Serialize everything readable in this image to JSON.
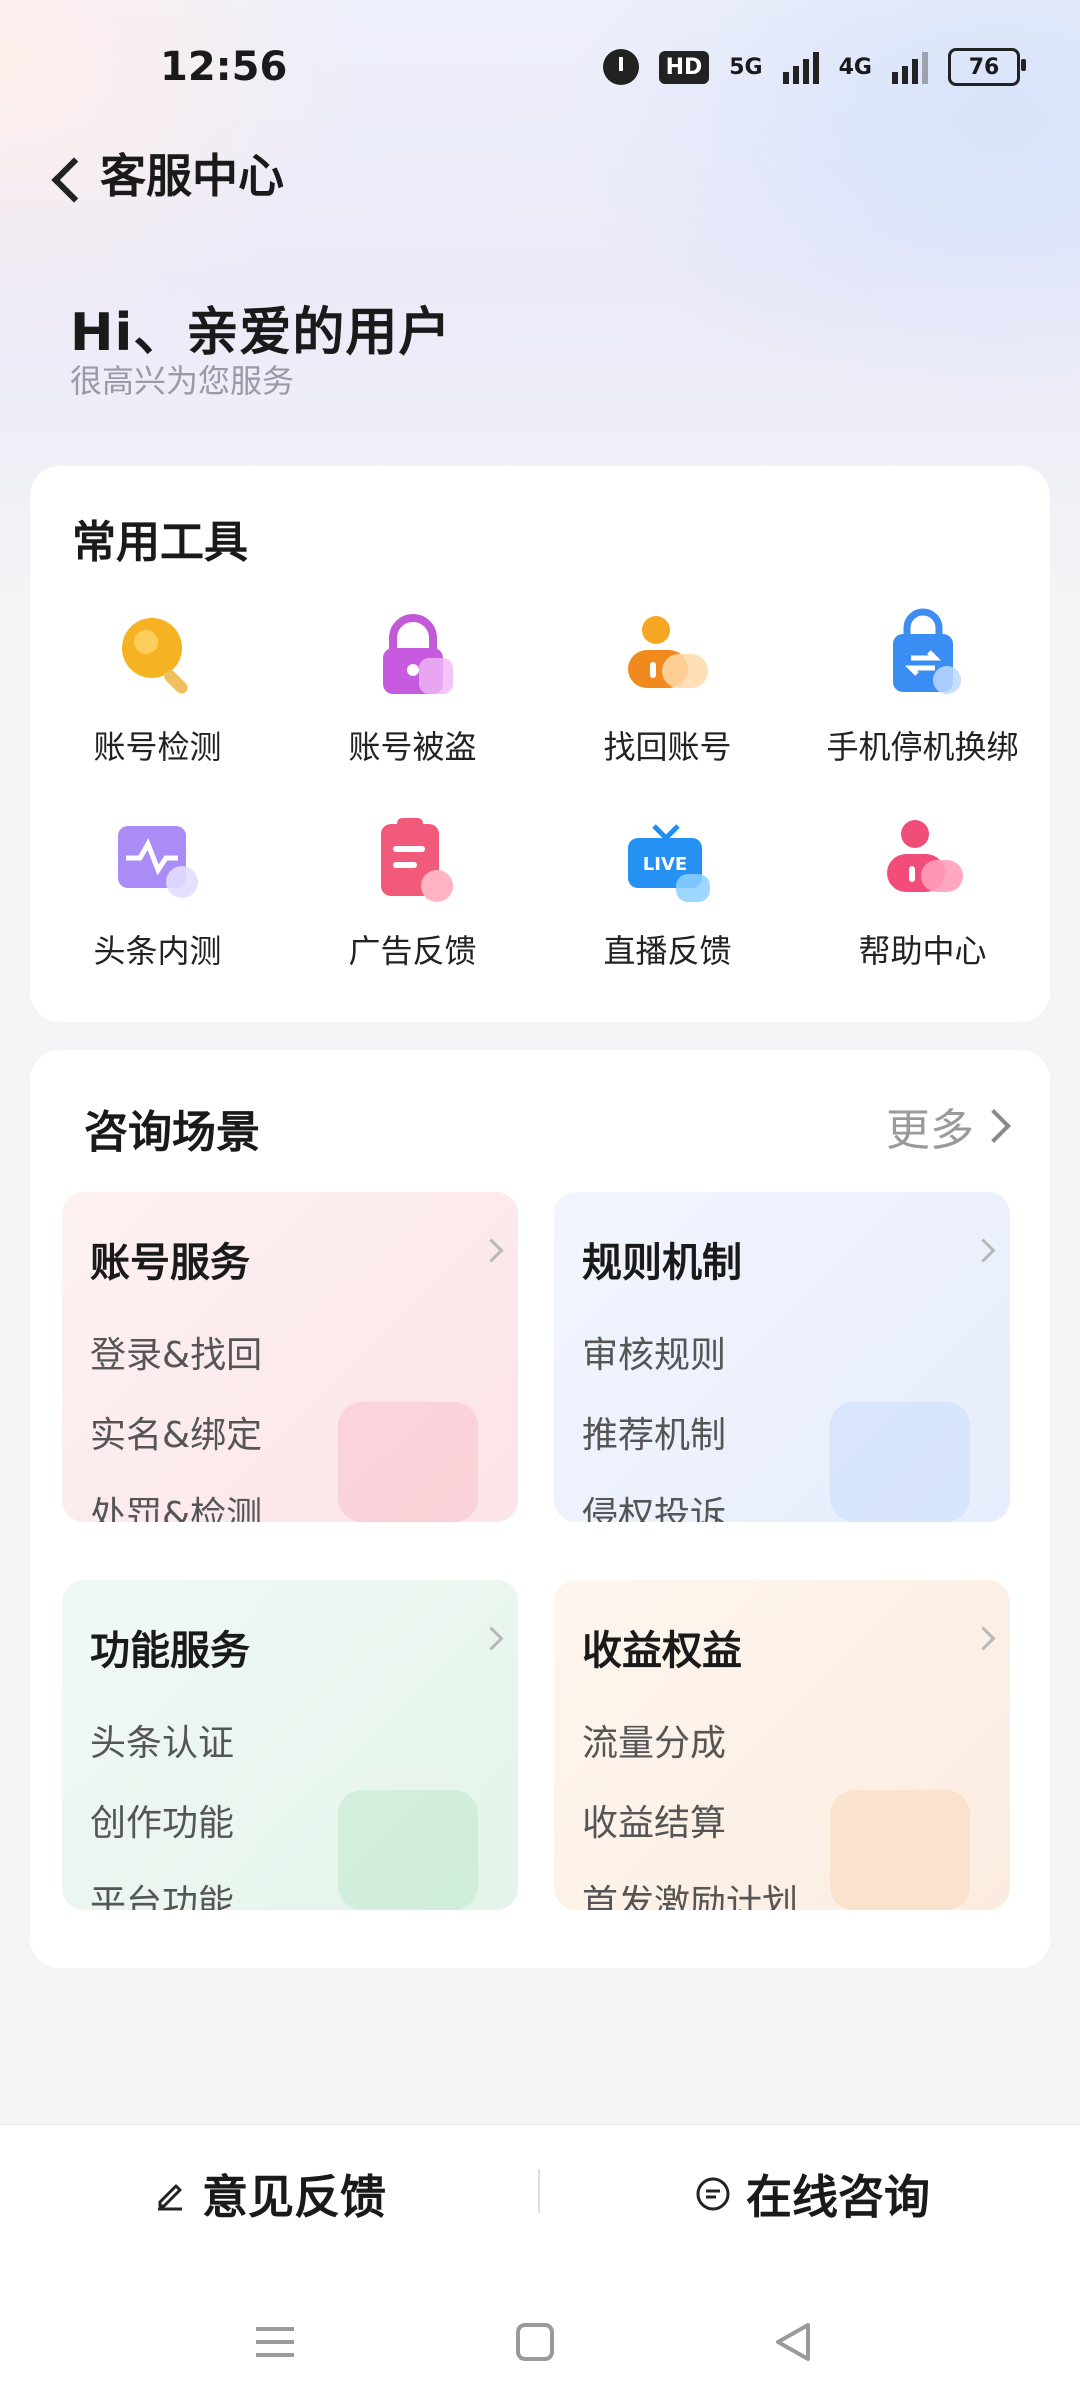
{
  "status_bar": {
    "time": "12:56",
    "hd_label": "HD",
    "net1": "5G",
    "net2": "4G",
    "battery": "76"
  },
  "nav": {
    "title": "客服中心"
  },
  "greeting": {
    "title": "Hi、亲爱的用户",
    "subtitle": "很高兴为您服务"
  },
  "tools": {
    "title": "常用工具",
    "items": [
      {
        "label": "账号检测",
        "icon": "magnifier-icon"
      },
      {
        "label": "账号被盗",
        "icon": "lock-icon"
      },
      {
        "label": "找回账号",
        "icon": "user-card-icon"
      },
      {
        "label": "手机停机换绑",
        "icon": "phone-lock-icon"
      },
      {
        "label": "头条内测",
        "icon": "pulse-icon"
      },
      {
        "label": "广告反馈",
        "icon": "clipboard-icon"
      },
      {
        "label": "直播反馈",
        "icon": "live-tv-icon"
      },
      {
        "label": "帮助中心",
        "icon": "support-user-icon"
      }
    ]
  },
  "consult": {
    "title": "咨询场景",
    "more": "更多",
    "scenes": [
      {
        "title": "账号服务",
        "items": [
          "登录&找回",
          "实名&绑定",
          "处罚&检测"
        ],
        "color": "#fde8ea"
      },
      {
        "title": "规则机制",
        "items": [
          "审核规则",
          "推荐机制",
          "侵权投诉"
        ],
        "color": "#e7eefc"
      },
      {
        "title": "功能服务",
        "items": [
          "头条认证",
          "创作功能",
          "平台功能"
        ],
        "color": "#e6f5ec"
      },
      {
        "title": "收益权益",
        "items": [
          "流量分成",
          "收益结算",
          "首发激励计划"
        ],
        "color": "#fdf0e4"
      }
    ]
  },
  "bottom_bar": {
    "feedback": "意见反馈",
    "online": "在线咨询"
  },
  "colors": {
    "background": "#f4f4f6",
    "card": "#ffffff",
    "muted_text": "#9a9aa6"
  }
}
